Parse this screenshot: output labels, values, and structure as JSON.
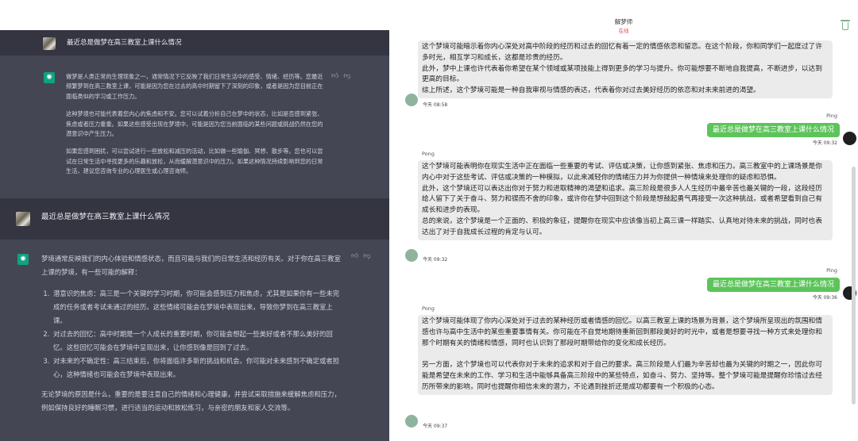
{
  "left": {
    "user_prompt_1": "最近总是做梦在高三教室上课什么情况",
    "bot_reply_1": [
      "做梦是人类正常的生理现象之一，通常情况下它反映了我们日常生活中的感受、情绪、经历等。您最近频繁梦到在高三教室上课，可能是因为您在过去的高中时期留下了深刻的印象，或者是因为您目前正在面临类似的学习或工作压力。",
      "这种梦境也可能代表着您内心的焦虑和不安。您可以试着分析自己在梦中的状态，比如是否感到紧张、焦虑或者压力重重。如果这些感受出现在梦境中，可能是因为您当前面临的某些问题或挑战仍然在您的潜意识中产生压力。",
      "如果您感到困扰，可以尝试进行一些放松和减压的活动，比如做一些瑜伽、冥想、散步等。您也可以尝试在日常生活中寻找更多的乐趣和放松，从而缓解潜意识中的压力。如果这种情况持续影响到您的日常生活，建议您咨询专业的心理医生或心理咨询师。"
    ],
    "user_prompt_2": "最近总是做梦在高三教室上课什么情况",
    "bot_reply_2": {
      "intro": "梦境通常反映我们的内心体验和情感状态，而且可能与我们的日常生活和经历有关。对于你在高三教室上课的梦境，有一些可能的解释：",
      "items": [
        "潜意识的焦虑：高三是一个关键的学习时期，你可能会感到压力和焦虑，尤其是如果你有一些未完成的任务或者考试未通过的经历。这些情绪可能会在梦境中表现出来，导致你梦到在高三教室上课。",
        "对过去的回忆：高中时期是一个人成长的重要时期，你可能会想起一些美好或者不那么美好的回忆。这些回忆可能会在梦境中呈现出来，让你感到像是回到了过去。",
        "对未来的不确定性：高三结束后，你将面临许多新的挑战和机会。你可能对未来感到不确定或者担心，这种情绪也可能会在梦境中表现出来。"
      ],
      "outro": "无论梦境的原因是什么，重要的是要注意自己的情绪和心理健康，并尝试采取措施来缓解焦虑和压力，例如保持良好的睡眠习惯，进行适当的运动和放松练习，与亲密的朋友和家人交流等。"
    },
    "thumb_up_icon": "thumbs-up-icon",
    "thumb_down_icon": "thumbs-down-icon"
  },
  "right": {
    "title": "解梦师",
    "status": "在线",
    "status_color": "#d9534f",
    "messages": {
      "m1_text": "这个梦境可能暗示着你内心深处对高中阶段的经历和过去的回忆有着一定的情感依恋和留恋。在这个阶段，你和同学们一起度过了许多时光，相互学习和成长，这都是珍贵的经历。\n此外，梦中上课也许代表着你希望在某个领域或某项技能上得到更多的学习与提升。你可能想要不断地自我提高，不断进步，以达到更高的目标。\n综上所述，这个梦境可能是一种自我审视与情感的表达，代表着你对过去美好经历的依恋和对未来前进的渴望。",
      "m1_time": "今天 08:58",
      "m2_sender": "Ping",
      "m2_text": "最近总是做梦在高三教室上课什么情况",
      "m2_time": "今天 09:32",
      "m3_sender": "Pong",
      "m3_text": "这个梦境可能表明你在现实生活中正在面临一些重要的考试、评估或决策，让你感到紧张、焦虑和压力。高三教室中的上课场景是你内心中对于这些考试、评估或决策的一种模拟，以此来减轻你的情绪压力并为你提供一种情境来处理你的疑虑和恐惧。\n此外，这个梦境还可以表达出你对于努力和进取精神的渴望和追求。高三阶段是很多人人生经历中最辛苦也最关键的一段，这段经历给人留下了关于奋斗、努力和锲而不舍的印象，或许你在梦中回到这个阶段是想鼓起勇气再接受一次这种挑战，或者希望看到自己有成长和进步的表现。\n总的来说，这个梦境是一个正面的、积极的象征，提醒你在现实中应该像当初上高三课一样踏实、认真地对待未来的挑战，同时也表达出了对于自我成长过程的肯定与认可。",
      "m3_time": "今天 09:32",
      "m4_sender": "Ping",
      "m4_text": "最近总是做梦在高三教室上课什么情况",
      "m4_time": "今天 09:36",
      "m5_sender": "Pong",
      "m5_text": "这个梦境可能体现了你内心深处对于过去的某种经历或者情感的回忆。以高三教室上课的场景为背景，这个梦境所呈现出的氛围和情感也许与高中生活中的某些重要事情有关。你可能在不自觉地期待重新回到那段美好的时光中，或者是想要寻找一种方式来处理你和那个时期有关的情绪和情感，同时也认识到了那段时期带给你的变化和成长经历。\n\n另一方面，这个梦境也可以代表你对于未来的追求和对于自己的要求。高三阶段是人们最为辛苦却也最为关键的时期之一，因此你可能是希望在未来的工作、学习和生活中能够具备高三阶段中的某些特点，如奋斗、努力、坚持等。整个梦境可能是提醒你珍惜过去经历所带来的影响，同时也提醒你相信未来的潜力，不论遇到挫折还是成功都要有一个积极的心态。",
      "m5_time": "今天 09:37"
    },
    "delete_icon": "trash-icon",
    "accent_color": "#5cc45a"
  }
}
